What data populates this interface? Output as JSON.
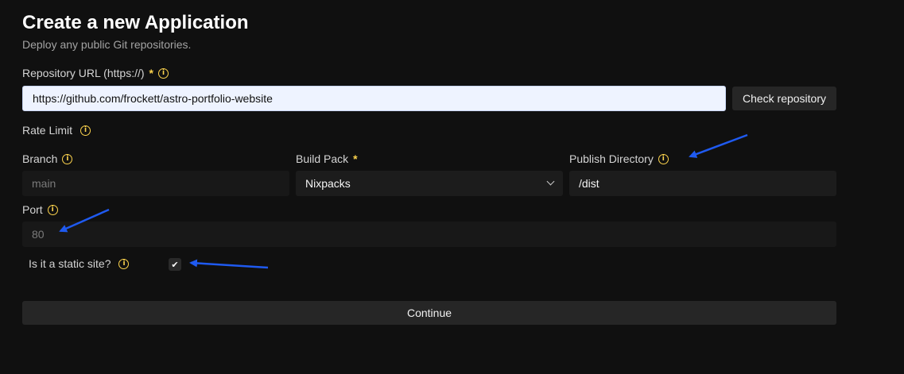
{
  "header": {
    "title": "Create a new Application",
    "subtitle": "Deploy any public Git repositories."
  },
  "repository": {
    "label": "Repository URL (https://)",
    "required_mark": "*",
    "value": "https://github.com/frockett/astro-portfolio-website",
    "check_button": "Check repository"
  },
  "rate_limit": {
    "label": "Rate Limit"
  },
  "branch": {
    "label": "Branch",
    "placeholder": "main"
  },
  "build_pack": {
    "label": "Build Pack",
    "required_mark": "*",
    "selected": "Nixpacks"
  },
  "publish_directory": {
    "label": "Publish Directory",
    "value": "/dist"
  },
  "port": {
    "label": "Port",
    "placeholder": "80"
  },
  "static_site": {
    "label": "Is it a static site?",
    "checked": true
  },
  "continue_button": "Continue",
  "icons": {
    "info": "i",
    "check": "✔"
  },
  "colors": {
    "background": "#101010",
    "accent_required": "#fcd34d",
    "annotation_arrow": "#1f5af0"
  }
}
